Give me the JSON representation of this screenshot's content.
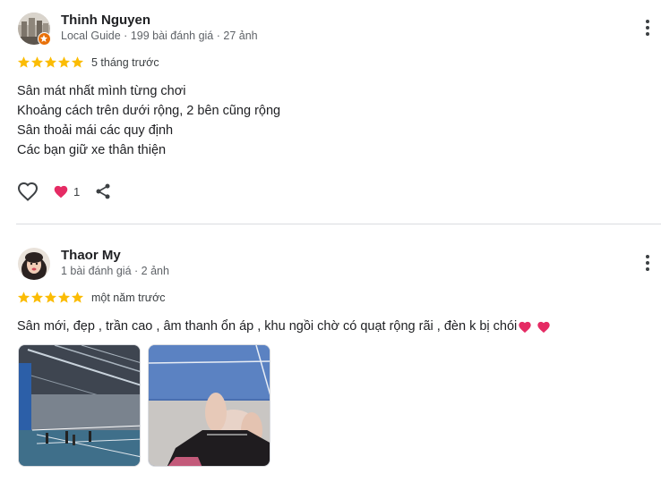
{
  "reviews": [
    {
      "author": "Thinh Nguyen",
      "meta": "Local Guide · 199 bài đánh giá · 27 ảnh",
      "rating": 5,
      "time": "5 tháng trước",
      "lines": [
        "Sân mát nhất mình từng chơi",
        "Khoảng cách trên dưới rộng, 2 bên cũng rộng",
        "Sân thoải mái các quy định",
        "Các bạn giữ xe thân thiện"
      ],
      "reaction_count": "1",
      "icons": [
        "like-heart-icon",
        "heart-reaction-icon",
        "share-icon",
        "more-vert-icon"
      ]
    },
    {
      "author": "Thaor My",
      "meta": "1 bài đánh giá · 2 ảnh",
      "rating": 5,
      "time": "một năm trước",
      "text": "Sân mới, đẹp , trần cao , âm thanh ổn áp , khu ngồi chờ có quạt rộng rãi , đèn k bị chói",
      "photos": [
        "indoor-badminton-court-photo",
        "legs-on-court-photo"
      ]
    }
  ],
  "colors": {
    "star": "#fbbc04",
    "heart": "#e52b64",
    "divider": "#dadce0"
  }
}
